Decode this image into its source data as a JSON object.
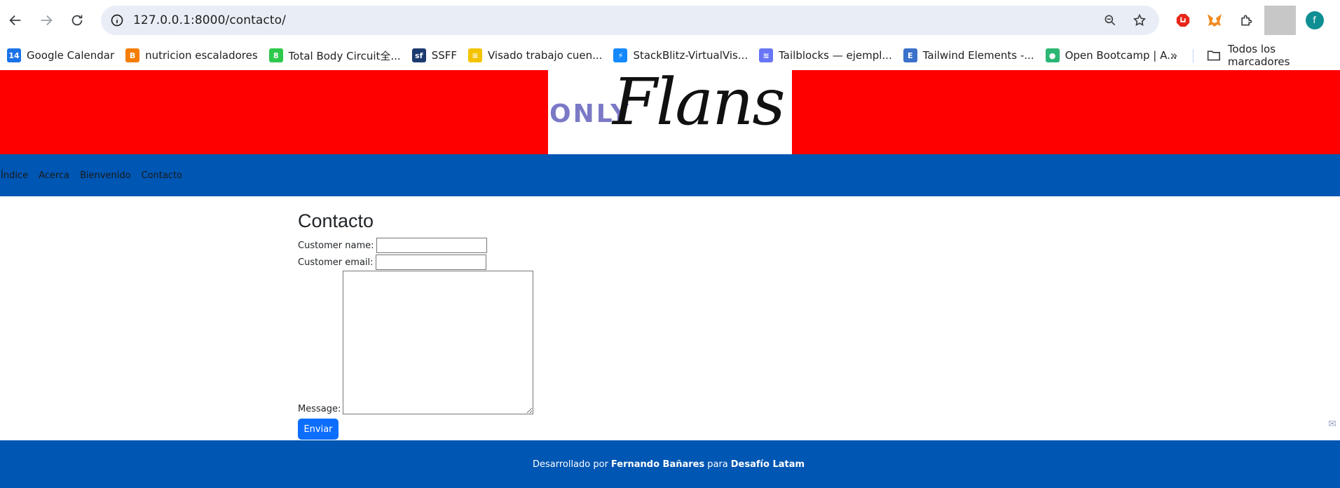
{
  "browser": {
    "url": "127.0.0.1:8000/contacto/",
    "profile_initial": "f",
    "bookmarks": [
      {
        "label": "Google Calendar",
        "icon": "calendar-icon",
        "color": "#1a73e8",
        "glyph": "14"
      },
      {
        "label": "nutricion escaladores",
        "icon": "blogger-icon",
        "color": "#f57d00",
        "glyph": "B"
      },
      {
        "label": "Total Body Circuit全...",
        "icon": "timer-icon",
        "color": "#2ec94c",
        "glyph": "8"
      },
      {
        "label": "SSFF",
        "icon": "sf-icon",
        "color": "#1b3b6f",
        "glyph": "sf"
      },
      {
        "label": "Visado trabajo cuen...",
        "icon": "visa-icon",
        "color": "#f4c300",
        "glyph": "≡"
      },
      {
        "label": "StackBlitz-VirtualVis...",
        "icon": "stackblitz-icon",
        "color": "#1389fd",
        "glyph": "⚡"
      },
      {
        "label": "Tailblocks — ejempl...",
        "icon": "tailblocks-icon",
        "color": "#6875f5",
        "glyph": "≋"
      },
      {
        "label": "Tailwind Elements -...",
        "icon": "tailwind-elements-icon",
        "color": "#3b71ca",
        "glyph": "E"
      },
      {
        "label": "Open Bootcamp | A...",
        "icon": "openbootcamp-icon",
        "color": "#2bb673",
        "glyph": "●"
      }
    ],
    "all_bookmarks_label": "Todos los marcadores"
  },
  "site": {
    "logo_only": "ONLY",
    "logo_flans": "Flans",
    "nav": [
      "Índice",
      "Acerca",
      "Bienvenido",
      "Contacto"
    ],
    "hero_color": "#ff0000",
    "nav_color": "#0056b3"
  },
  "form": {
    "title": "Contacto",
    "name_label": "Customer name:",
    "name_value": "",
    "email_label": "Customer email:",
    "email_value": "",
    "message_label": "Message:",
    "message_value": "",
    "submit_label": "Enviar"
  },
  "footer": {
    "prefix": "Desarrollado por",
    "author": "Fernando Bañares",
    "middle": "para",
    "org": "Desafío Latam"
  }
}
